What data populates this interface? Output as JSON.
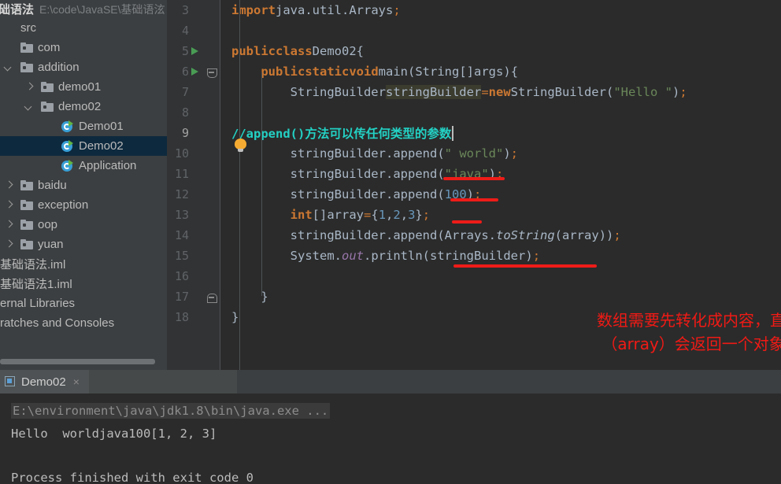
{
  "app": {
    "theme_background": "#3c3f41",
    "editor_background": "#2b2b2b",
    "accent": "#4a88c7"
  },
  "sidebar": {
    "project_name": "础语法",
    "project_path": "E:\\code\\JavaSE\\基础语泫",
    "hscroll": true,
    "items": [
      {
        "label": "src",
        "indent": 0,
        "arrow": "none",
        "icon": "none",
        "selected": false
      },
      {
        "label": "com",
        "indent": 0,
        "arrow": "none",
        "icon": "folder-icon",
        "selected": false
      },
      {
        "label": "addition",
        "indent": 0,
        "arrow": "down",
        "icon": "folder-icon",
        "selected": false
      },
      {
        "label": "demo01",
        "indent": 1,
        "arrow": "right",
        "icon": "folder-icon",
        "selected": false
      },
      {
        "label": "demo02",
        "indent": 1,
        "arrow": "down",
        "icon": "folder-icon",
        "selected": false
      },
      {
        "label": "Demo01",
        "indent": 2,
        "arrow": "none",
        "icon": "class-icon",
        "selected": false
      },
      {
        "label": "Demo02",
        "indent": 2,
        "arrow": "none",
        "icon": "class-icon",
        "selected": true
      },
      {
        "label": "Application",
        "indent": 2,
        "arrow": "none",
        "icon": "class-icon",
        "selected": false
      },
      {
        "label": "baidu",
        "indent": 0,
        "arrow": "right",
        "icon": "folder-icon",
        "selected": false
      },
      {
        "label": "exception",
        "indent": 0,
        "arrow": "right",
        "icon": "folder-icon",
        "selected": false
      },
      {
        "label": "oop",
        "indent": 0,
        "arrow": "right",
        "icon": "folder-icon",
        "selected": false
      },
      {
        "label": "yuan",
        "indent": 0,
        "arrow": "right",
        "icon": "folder-icon",
        "selected": false
      },
      {
        "label": "基础语法.iml",
        "indent": -1,
        "arrow": "none",
        "icon": "none",
        "selected": false
      },
      {
        "label": "基础语法1.iml",
        "indent": -1,
        "arrow": "none",
        "icon": "none",
        "selected": false
      },
      {
        "label": "ernal Libraries",
        "indent": -1,
        "arrow": "none",
        "icon": "none",
        "selected": false
      },
      {
        "label": "ratches and Consoles",
        "indent": -1,
        "arrow": "none",
        "icon": "none",
        "selected": false
      }
    ]
  },
  "editor": {
    "current_line": 9,
    "caret_after_line": 9,
    "lines": [
      {
        "num": "3",
        "run_marker": false,
        "fold": "none",
        "text": "import java.util.Arrays;"
      },
      {
        "num": "4",
        "run_marker": false,
        "fold": "none",
        "text": ""
      },
      {
        "num": "5",
        "run_marker": true,
        "fold": "none",
        "text": "public class Demo02 {"
      },
      {
        "num": "6",
        "run_marker": true,
        "fold": "close",
        "text": "    public static void main(String[] args) {"
      },
      {
        "num": "7",
        "run_marker": false,
        "fold": "none",
        "text": "        StringBuilder stringBuilder = new StringBuilder(\"Hello \");"
      },
      {
        "num": "8",
        "run_marker": false,
        "fold": "none",
        "text": ""
      },
      {
        "num": "9",
        "run_marker": false,
        "fold": "none",
        "text": "        //append()方法可以传任何类型的参数"
      },
      {
        "num": "10",
        "run_marker": false,
        "fold": "none",
        "text": "        stringBuilder.append(\" world\");"
      },
      {
        "num": "11",
        "run_marker": false,
        "fold": "none",
        "text": "        stringBuilder.append(\"java\");"
      },
      {
        "num": "12",
        "run_marker": false,
        "fold": "none",
        "text": "        stringBuilder.append(100);"
      },
      {
        "num": "13",
        "run_marker": false,
        "fold": "none",
        "text": "        int[] array={1,2,3};"
      },
      {
        "num": "14",
        "run_marker": false,
        "fold": "none",
        "text": "        stringBuilder.append(Arrays.toString(array));"
      },
      {
        "num": "15",
        "run_marker": false,
        "fold": "none",
        "text": "        System.out.println(stringBuilder);"
      },
      {
        "num": "16",
        "run_marker": false,
        "fold": "none",
        "text": ""
      },
      {
        "num": "17",
        "run_marker": false,
        "fold": "open",
        "text": "    }"
      },
      {
        "num": "18",
        "run_marker": false,
        "fold": "none",
        "text": "}"
      }
    ],
    "highlighted_identifier": "stringBuilder",
    "inspection_hint_icon": "lightbulb-icon",
    "annotation": {
      "color": "#f01a15",
      "line1": "数组需要先转化成内容，直接append",
      "line2": " （array）会返回一个对象"
    },
    "red_underline_color": "#ee1c18"
  },
  "console": {
    "tab_label": "Demo02",
    "tab_icon": "run-config-icon",
    "close_icon": "×",
    "lines": [
      {
        "text": "E:\\environment\\java\\jdk1.8\\bin\\java.exe ...",
        "style": "dim"
      },
      {
        "text": "Hello  worldjava100[1, 2, 3]",
        "style": "normal"
      },
      {
        "text": "Process finished with exit code 0",
        "style": "normal"
      }
    ]
  }
}
